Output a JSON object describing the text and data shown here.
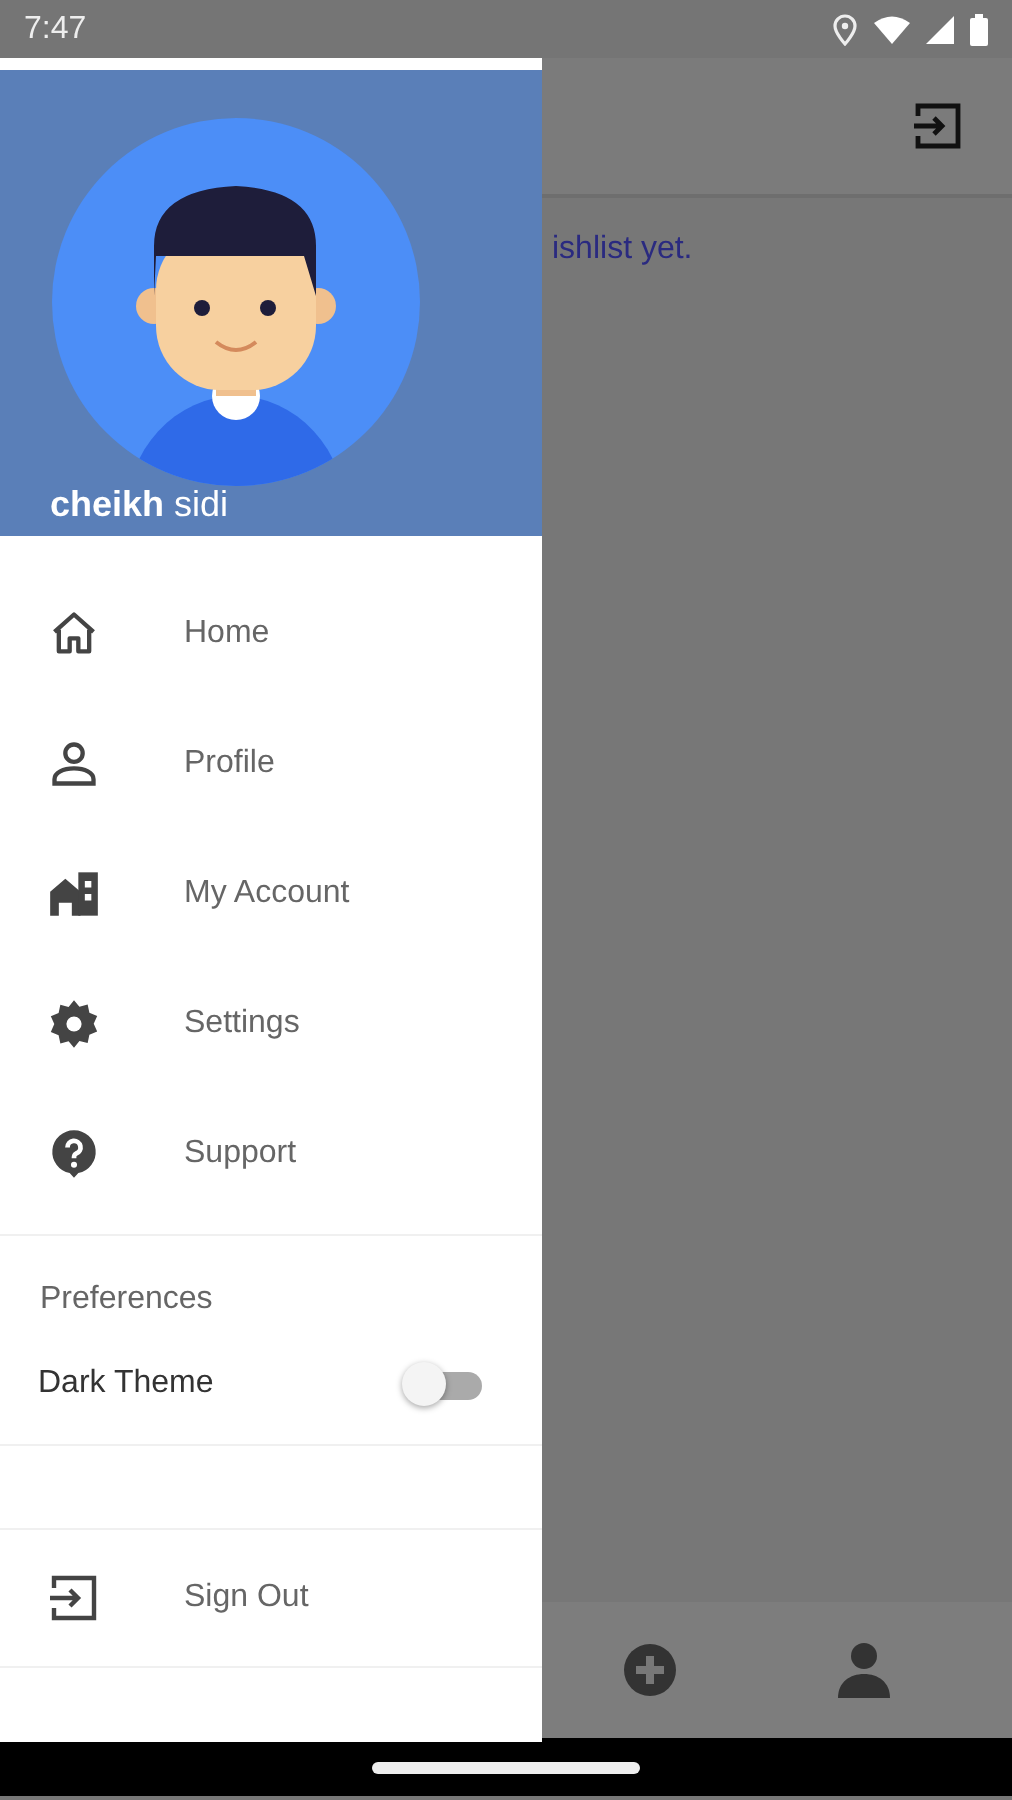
{
  "status_bar": {
    "time": "7:47"
  },
  "background_screen": {
    "message": "ishlist yet."
  },
  "drawer": {
    "user_name": "**cheikh** sidi",
    "menu_items": [
      {
        "label": "Home",
        "kind": "home"
      },
      {
        "label": "Profile",
        "kind": "profile"
      },
      {
        "label": "My Account",
        "kind": "account"
      },
      {
        "label": "Settings",
        "kind": "settings"
      },
      {
        "label": "Support",
        "kind": "support"
      }
    ],
    "preferences": {
      "title": "Preferences",
      "settings": [
        {
          "label": "Dark Theme",
          "on": false
        }
      ]
    },
    "sign_out": {
      "label": "Sign Out"
    }
  }
}
